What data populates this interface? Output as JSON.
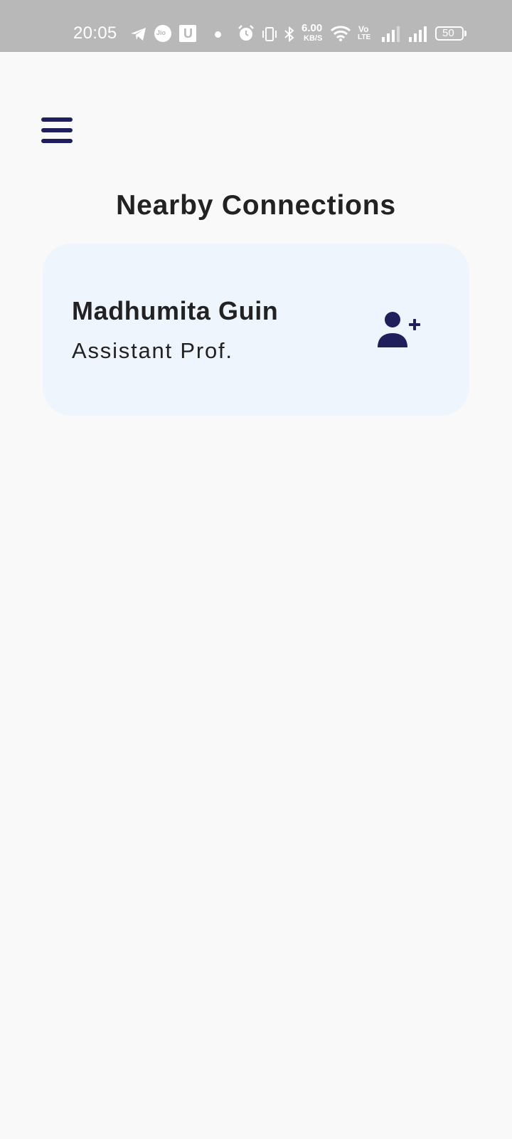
{
  "status_bar": {
    "time": "20:05",
    "network_speed_value": "6.00",
    "network_speed_unit": "KB/S",
    "volte_top": "Vo",
    "volte_bottom": "LTE",
    "battery_level": "50",
    "icons": [
      "telegram-icon",
      "jio-icon",
      "u-app-icon",
      "dot-icon",
      "alarm-icon",
      "vibrate-icon",
      "bluetooth-icon",
      "wifi-icon",
      "volte-icon",
      "signal-icon",
      "signal-icon",
      "battery-icon"
    ]
  },
  "header": {
    "menu_icon": "hamburger-menu-icon",
    "title": "Nearby Connections"
  },
  "connections": [
    {
      "name": "Madhumita Guin",
      "role": "Assistant Prof.",
      "action_icon": "add-user-icon"
    }
  ],
  "colors": {
    "accent": "#1f1f5c",
    "card_background": "#eef5fd",
    "page_background": "#f9f9f9",
    "status_bar": "#b8b8b8",
    "text": "#222222"
  }
}
